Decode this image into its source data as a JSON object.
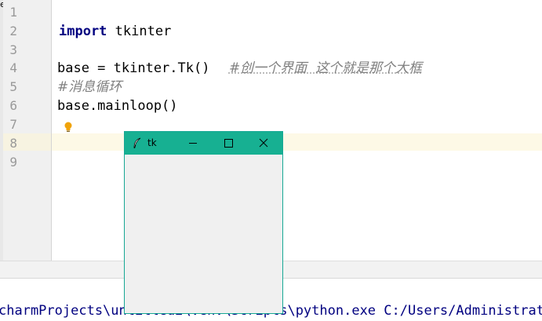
{
  "editor": {
    "line_numbers": [
      "1",
      "2",
      "3",
      "4",
      "5",
      "6",
      "7",
      "8",
      "9"
    ],
    "lines": {
      "l2_keyword": "import",
      "l2_rest": " tkinter",
      "l4_code": "base = tkinter.Tk()  ",
      "l4_comment": "#创一个界面  这个就是那个大框",
      "l5_comment": "#消息循环",
      "l6_code": "base.mainloop()"
    },
    "top_glyph": "e"
  },
  "console": {
    "command_text": "charmProjects\\untitled2\\venv\\Scripts\\python.exe C:/Users/Administrator"
  },
  "tk_window": {
    "title": "tk",
    "titlebar_color": "#17b092",
    "icons": {
      "app": "feather-icon",
      "minimize": "minimize-icon",
      "maximize": "maximize-icon",
      "close": "close-icon"
    }
  },
  "colors": {
    "keyword": "#000080",
    "comment": "#808080",
    "current_line": "#fdf9e6",
    "bulb": "#f0a30a"
  }
}
